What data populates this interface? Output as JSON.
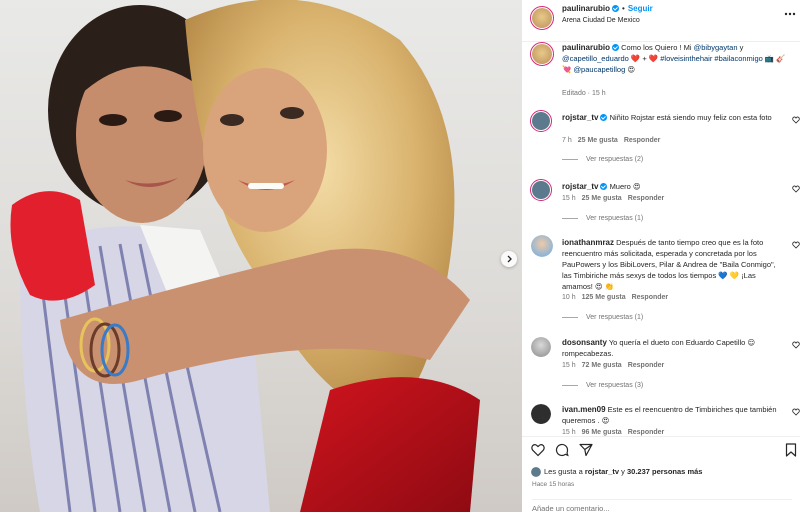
{
  "post": {
    "username": "paulinarubio",
    "follow_label": "Seguir",
    "separator": "•",
    "location": "Arena Ciudad De Mexico"
  },
  "caption": {
    "username": "paulinarubio",
    "text_1": "Como los Quiero ! Mi ",
    "mention_1": "@bibygaytan",
    "text_2": " y ",
    "mention_2": "@capetillo_eduardo",
    "emoji_1": " ❤️ + ❤️",
    "hashtags": "#loveisinthehair #bailaconmigo",
    "emoji_2": " 📺 🎸 💘",
    "mention_3": "@paucapetillog",
    "emoji_3": " 😍",
    "edited": "Editado · 15 h"
  },
  "comments": [
    {
      "username": "rojstar_tv",
      "text": "Niñito Rojstar está siendo muy feliz con esta foto",
      "time": "7 h",
      "likes": "25 Me gusta",
      "reply": "Responder",
      "replies": "Ver respuestas (2)"
    },
    {
      "username": "rojstar_tv",
      "text": "Muero 😍",
      "time": "15 h",
      "likes": "25 Me gusta",
      "reply": "Responder",
      "replies": "Ver respuestas (1)"
    },
    {
      "username": "ionathanmraz",
      "text": "Después de tanto tiempo creo que es la foto reencuentro más solicitada, esperada y concretada por los PauPowers y los BibiLovers, Pilar & Andrea de \"Baila Conmigo\", las Timbiriche más sexys de todos los tiempos 💙 💛 ¡Las amamos! 😍 👏",
      "time": "10 h",
      "likes": "125 Me gusta",
      "reply": "Responder",
      "replies": "Ver respuestas (1)"
    },
    {
      "username": "dosonsanty",
      "text": "Yo quería el dueto con Eduardo Capetillo 😌 rompecabezas.",
      "time": "15 h",
      "likes": "72 Me gusta",
      "reply": "Responder",
      "replies": "Ver respuestas (3)"
    },
    {
      "username": "ivan.men09",
      "text": "Este es el reencuentro de Timbiriches que también queremos . 😍",
      "time": "15 h",
      "likes": "96 Me gusta",
      "reply": "Responder"
    }
  ],
  "footer": {
    "liked_by_prefix": "Les gusta a ",
    "liked_by_user": "rojstar_tv",
    "liked_by_middle": " y ",
    "liked_by_count": "30.237 personas más",
    "time_ago": "Hace 15 horas",
    "add_comment_placeholder": "Añade un comentario..."
  },
  "colors": {
    "accent": "#0095f6",
    "link": "#00376b",
    "muted": "#737373"
  },
  "icons": [
    "like-icon",
    "comment-icon",
    "share-icon",
    "save-icon",
    "verified-icon",
    "chevron-right-icon"
  ]
}
